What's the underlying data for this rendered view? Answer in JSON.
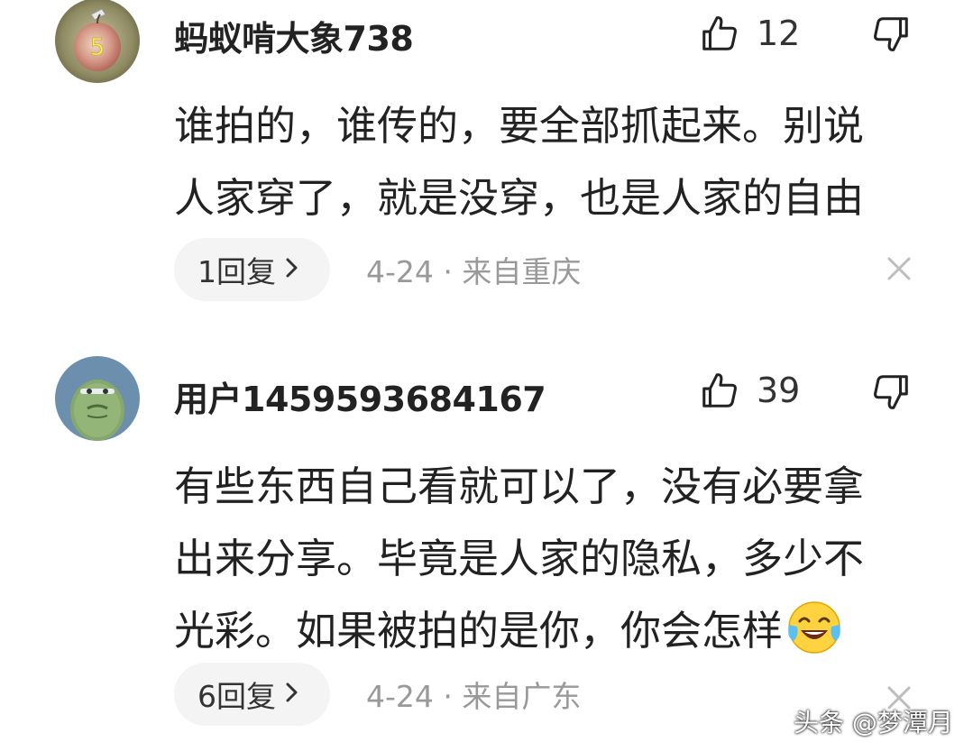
{
  "comments": [
    {
      "username": "蚂蚁啃大象738",
      "avatar": "avatar-user-1",
      "likes": "12",
      "content_lines": [
        "谁拍的，谁传的，要全部抓起来。别说",
        "人家穿了，就是没穿，也是人家的自由"
      ],
      "reply_label": "1回复",
      "meta": "4-24 · 来自重庆"
    },
    {
      "username": "用户1459593684167",
      "avatar": "avatar-user-2",
      "likes": "39",
      "content_lines": [
        "有些东西自己看就可以了，没有必要拿",
        "出来分享。毕竟是人家的隐私，多少不",
        "光彩。如果被拍的是你，你会怎样"
      ],
      "content_emoji": "laughing-crying-emoji",
      "reply_label": "6回复",
      "meta": "4-24 · 来自广东"
    }
  ],
  "icons": {
    "like": "thumbs-up-icon",
    "dislike": "thumbs-down-icon",
    "chevron": "chevron-right-icon",
    "close": "close-icon"
  },
  "watermark": "头条 @梦潭月"
}
